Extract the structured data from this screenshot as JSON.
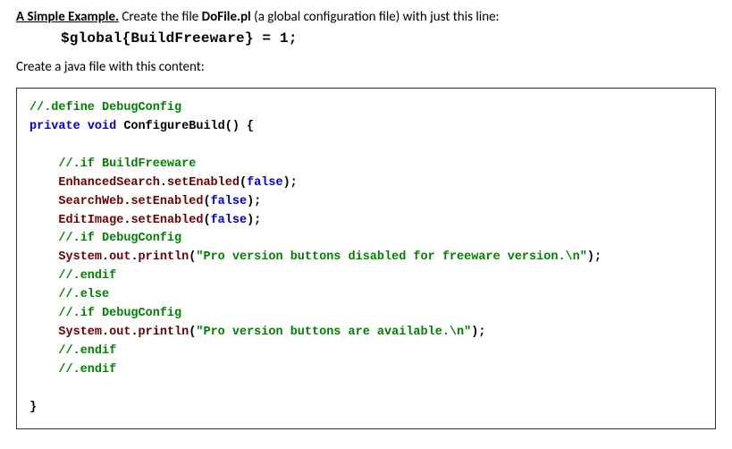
{
  "intro": {
    "heading": "A Simple Example.",
    "text1a": "  Create the file ",
    "filename": "DoFile.pl",
    "text1b": " (a global configuration file) with just this line:"
  },
  "config_line": "$global{BuildFreeware} = 1;",
  "subline": "Create a java file with this content:",
  "c": {
    "l1a": "//.define DebugConfig",
    "l2a": "private",
    "l2b": " ",
    "l2c": "void",
    "l2d": " ConfigureBuild() {",
    "l4a": "    //.if BuildFreeware",
    "l5a": "    EnhancedSearch",
    "l5b": ".",
    "l5c": "setEnabled",
    "l5d": "(",
    "l5e": "false",
    "l5f": ");",
    "l6a": "    SearchWeb",
    "l6b": ".",
    "l6c": "setEnabled",
    "l6d": "(",
    "l6e": "false",
    "l6f": ");",
    "l7a": "    EditImage",
    "l7b": ".",
    "l7c": "setEnabled",
    "l7d": "(",
    "l7e": "false",
    "l7f": ");",
    "l8a": "    //.if DebugConfig",
    "l9a": "    System",
    "l9b": ".",
    "l9c": "out",
    "l9d": ".",
    "l9e": "println",
    "l9f": "(",
    "l9g": "\"Pro version buttons disabled for freeware version.\\n\"",
    "l9h": ");",
    "l10a": "    //.endif",
    "l11a": "    //.else",
    "l12a": "    //.if DebugConfig",
    "l13a": "    System",
    "l13b": ".",
    "l13c": "out",
    "l13d": ".",
    "l13e": "println",
    "l13f": "(",
    "l13g": "\"Pro version buttons are available.\\n\"",
    "l13h": ");",
    "l14a": "    //.endif",
    "l15a": "    //.endif",
    "l17a": "}"
  }
}
